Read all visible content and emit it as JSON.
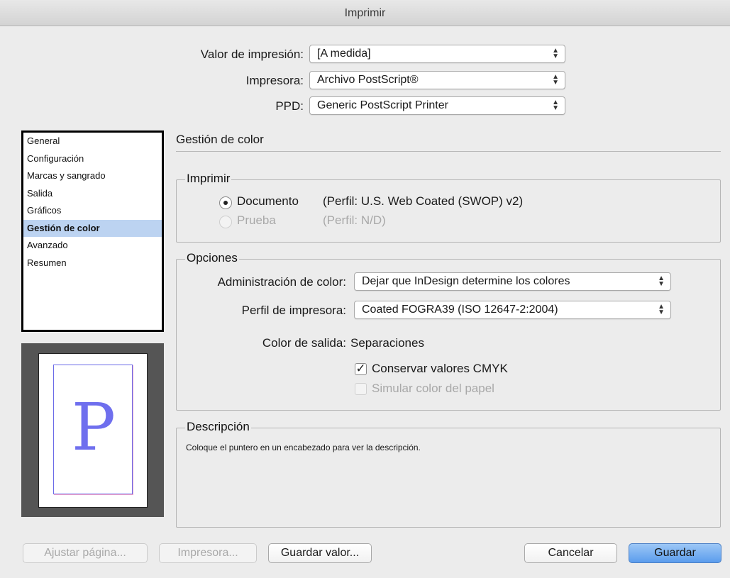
{
  "window": {
    "title": "Imprimir"
  },
  "top_fields": {
    "preset_label": "Valor de impresión:",
    "preset_value": "[A medida]",
    "printer_label": "Impresora:",
    "printer_value": "Archivo PostScript®",
    "ppd_label": "PPD:",
    "ppd_value": "Generic PostScript Printer"
  },
  "sidebar": {
    "items": [
      {
        "label": "General"
      },
      {
        "label": "Configuración"
      },
      {
        "label": "Marcas y sangrado"
      },
      {
        "label": "Salida"
      },
      {
        "label": "Gráficos"
      },
      {
        "label": "Gestión de color"
      },
      {
        "label": "Avanzado"
      },
      {
        "label": "Resumen"
      }
    ],
    "selected": "Gestión de color"
  },
  "preview": {
    "letter": "P"
  },
  "section": {
    "title": "Gestión de color"
  },
  "print_group": {
    "title": "Imprimir",
    "document_label": "Documento",
    "document_profile": "(Perfil: U.S. Web Coated (SWOP) v2)",
    "proof_label": "Prueba",
    "proof_profile": "(Perfil: N/D)"
  },
  "options_group": {
    "title": "Opciones",
    "color_handling_label": "Administración de color:",
    "color_handling_value": "Dejar que InDesign determine los colores",
    "printer_profile_label": "Perfil de impresora:",
    "printer_profile_value": "Coated FOGRA39 (ISO 12647-2:2004)",
    "output_color_label": "Color de salida:",
    "output_color_value": "Separaciones",
    "preserve_cmyk_label": "Conservar valores CMYK",
    "simulate_paper_label": "Simular color del papel"
  },
  "description_group": {
    "title": "Descripción",
    "text": "Coloque el puntero en un encabezado para ver la descripción."
  },
  "buttons": {
    "page_setup": "Ajustar página...",
    "printer": "Impresora...",
    "save_preset": "Guardar valor...",
    "cancel": "Cancelar",
    "save": "Guardar"
  },
  "icons": {
    "popup_arrows": "updown-chevron-icon",
    "check": "checkmark-icon"
  },
  "colors": {
    "selection": "#bcd3f1",
    "primary_button": "#5b9ded",
    "preview_letter": "#6f6fee"
  }
}
